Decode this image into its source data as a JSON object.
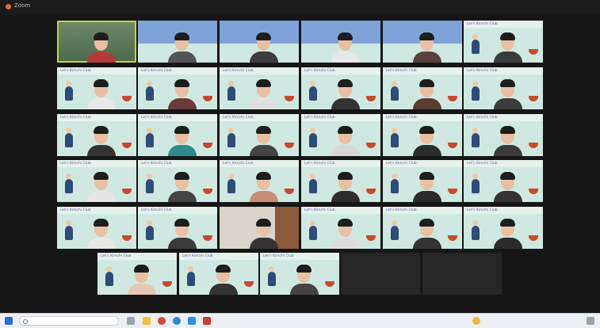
{
  "window": {
    "title": "Zoom"
  },
  "banner_text": "Let's Kimchi Club",
  "tiles": [
    {
      "num": "",
      "name": "",
      "bg": "campus",
      "speaking": true,
      "shirt": "#b33a3a"
    },
    {
      "num": "",
      "name": "",
      "bg": "sky",
      "shirt": "#555"
    },
    {
      "num": "",
      "name": "",
      "bg": "sky",
      "shirt": "#3c3c3c"
    },
    {
      "num": "",
      "name": "",
      "bg": "sky",
      "shirt": "#e8e8e8"
    },
    {
      "num": "",
      "name": "",
      "bg": "sky",
      "shirt": "#5a3f3f"
    },
    {
      "num": "",
      "name": "",
      "bg": "mint",
      "shirt": "#3a3a3a"
    },
    {
      "num": "",
      "name": "",
      "bg": "mint",
      "shirt": "#e8e8e8"
    },
    {
      "num": "",
      "name": "",
      "bg": "mint",
      "shirt": "#6a3a3a"
    },
    {
      "num": "",
      "name": "",
      "bg": "mint",
      "shirt": "#e0e0e0"
    },
    {
      "num": "",
      "name": "",
      "bg": "mint",
      "shirt": "#333"
    },
    {
      "num": "",
      "name": "",
      "bg": "mint",
      "shirt": "#5a3b2e"
    },
    {
      "num": "",
      "name": "",
      "bg": "mint",
      "shirt": "#3d3d3d"
    },
    {
      "num": "",
      "name": "",
      "bg": "mint",
      "shirt": "#333"
    },
    {
      "num": "",
      "name": "",
      "bg": "mint",
      "shirt": "#2f8a8a"
    },
    {
      "num": "",
      "name": "",
      "bg": "mint",
      "shirt": "#444"
    },
    {
      "num": "",
      "name": "",
      "bg": "mint",
      "shirt": "#d8d8d8"
    },
    {
      "num": "",
      "name": "",
      "bg": "mint",
      "shirt": "#2c2c2c"
    },
    {
      "num": "",
      "name": "",
      "bg": "mint",
      "shirt": "#3a3a3a"
    },
    {
      "num": "",
      "name": "",
      "bg": "mint",
      "shirt": "#e5e5e5"
    },
    {
      "num": "",
      "name": "",
      "bg": "mint",
      "shirt": "#444"
    },
    {
      "num": "",
      "name": "",
      "bg": "mint",
      "shirt": "#c98e7a"
    },
    {
      "num": "",
      "name": "",
      "bg": "mint",
      "shirt": "#2e2e2e"
    },
    {
      "num": "",
      "name": "",
      "bg": "mint",
      "shirt": "#2a2a2a"
    },
    {
      "num": "",
      "name": "",
      "bg": "mint",
      "shirt": "#333"
    },
    {
      "num": "",
      "name": "",
      "bg": "mint",
      "shirt": "#e9e9e9"
    },
    {
      "num": "",
      "name": "",
      "bg": "mint",
      "shirt": "#3b3b3b"
    },
    {
      "num": "",
      "name": "",
      "bg": "room",
      "shirt": "#333"
    },
    {
      "num": "",
      "name": "",
      "bg": "mint",
      "shirt": "#ddd"
    },
    {
      "num": "",
      "name": "",
      "bg": "mint",
      "shirt": "#333"
    },
    {
      "num": "",
      "name": "",
      "bg": "mint",
      "shirt": "#2b2b2b"
    },
    {
      "num": "",
      "name": "",
      "bg": "mint",
      "shirt": "#e6c9b5"
    },
    {
      "num": "",
      "name": "",
      "bg": "mint",
      "shirt": "#333"
    },
    {
      "num": "",
      "name": "",
      "bg": "mint",
      "shirt": "#444"
    },
    {
      "num": "",
      "name": "",
      "bg": "dark",
      "label": ""
    },
    {
      "num": "",
      "name": "",
      "bg": "dark",
      "label": ""
    }
  ],
  "taskbar": {
    "search_placeholder": "",
    "clock_time": "",
    "clock_date": ""
  },
  "colors": {
    "tile_bg": "#cfe9e2",
    "banner_text": "#6b5ba6",
    "speaker_border": "#c9d23a",
    "muted": "#e03c31"
  }
}
